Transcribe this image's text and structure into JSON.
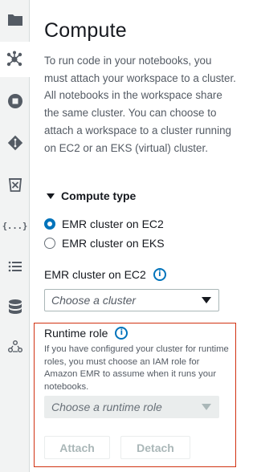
{
  "sidebar": {
    "items": [
      {
        "icon": "folder-icon"
      },
      {
        "icon": "cluster-icon",
        "active": true
      },
      {
        "icon": "stop-icon"
      },
      {
        "icon": "git-icon"
      },
      {
        "icon": "trash-icon"
      },
      {
        "icon": "braces-icon",
        "label": "{...}"
      },
      {
        "icon": "list-icon"
      },
      {
        "icon": "database-icon"
      },
      {
        "icon": "people-icon"
      }
    ]
  },
  "panel": {
    "title": "Compute",
    "description": "To run code in your notebooks, you must attach your workspace to a cluster. All notebooks in the workspace share the same cluster. You can choose to attach a workspace to a cluster running on EC2 or an EKS (virtual) cluster.",
    "compute_type": {
      "header": "Compute type",
      "options": [
        {
          "label": "EMR cluster on EC2",
          "selected": true
        },
        {
          "label": "EMR cluster on EKS",
          "selected": false
        }
      ]
    },
    "cluster_field": {
      "label": "EMR cluster on EC2",
      "info_icon": "i",
      "placeholder": "Choose a cluster"
    },
    "runtime_role": {
      "label": "Runtime role",
      "info_icon": "i",
      "description": "If you have configured your cluster for runtime roles, you must choose an IAM role for Amazon EMR to assume when it runs your notebooks.",
      "placeholder": "Choose a runtime role"
    },
    "buttons": {
      "attach": "Attach",
      "detach": "Detach"
    }
  },
  "colors": {
    "accent": "#0073bb",
    "highlight_border": "#d13212",
    "sidebar_bg": "#f2f3f3"
  }
}
